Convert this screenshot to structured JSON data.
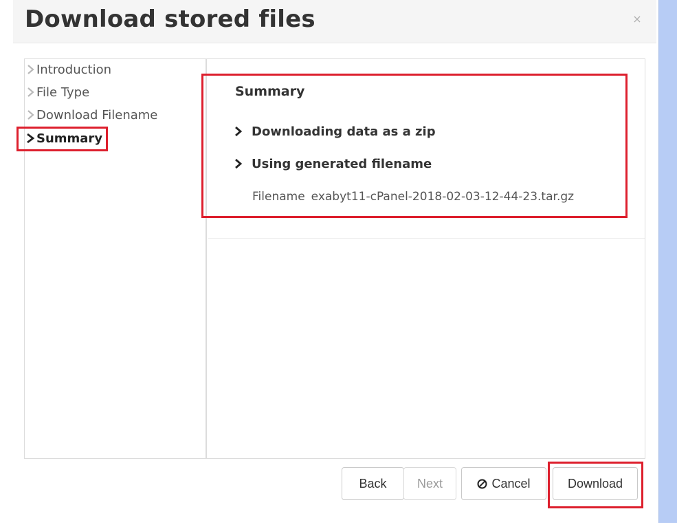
{
  "dialog": {
    "title": "Download stored files",
    "close_glyph": "×"
  },
  "steps": [
    {
      "label": "Introduction",
      "active": false
    },
    {
      "label": "File Type",
      "active": false
    },
    {
      "label": "Download Filename",
      "active": false
    },
    {
      "label": "Summary",
      "active": true
    }
  ],
  "summary": {
    "title": "Summary",
    "items": [
      {
        "label": "Downloading data as a zip"
      },
      {
        "label": "Using generated filename"
      }
    ],
    "filename_label": "Filename",
    "filename_value": "exabyt11-cPanel-2018-02-03-12-44-23.tar.gz"
  },
  "buttons": {
    "back": "Back",
    "next": "Next",
    "cancel": "Cancel",
    "download": "Download"
  },
  "icons": {
    "close": "close-icon",
    "step_chevron": "chevron-right-icon",
    "summary_chevron": "chevron-right-icon",
    "cancel": "ban-icon"
  },
  "colors": {
    "highlight": "#dd1f2d",
    "header_bg": "#f5f5f5",
    "side_strip": "#b7ccf5"
  }
}
